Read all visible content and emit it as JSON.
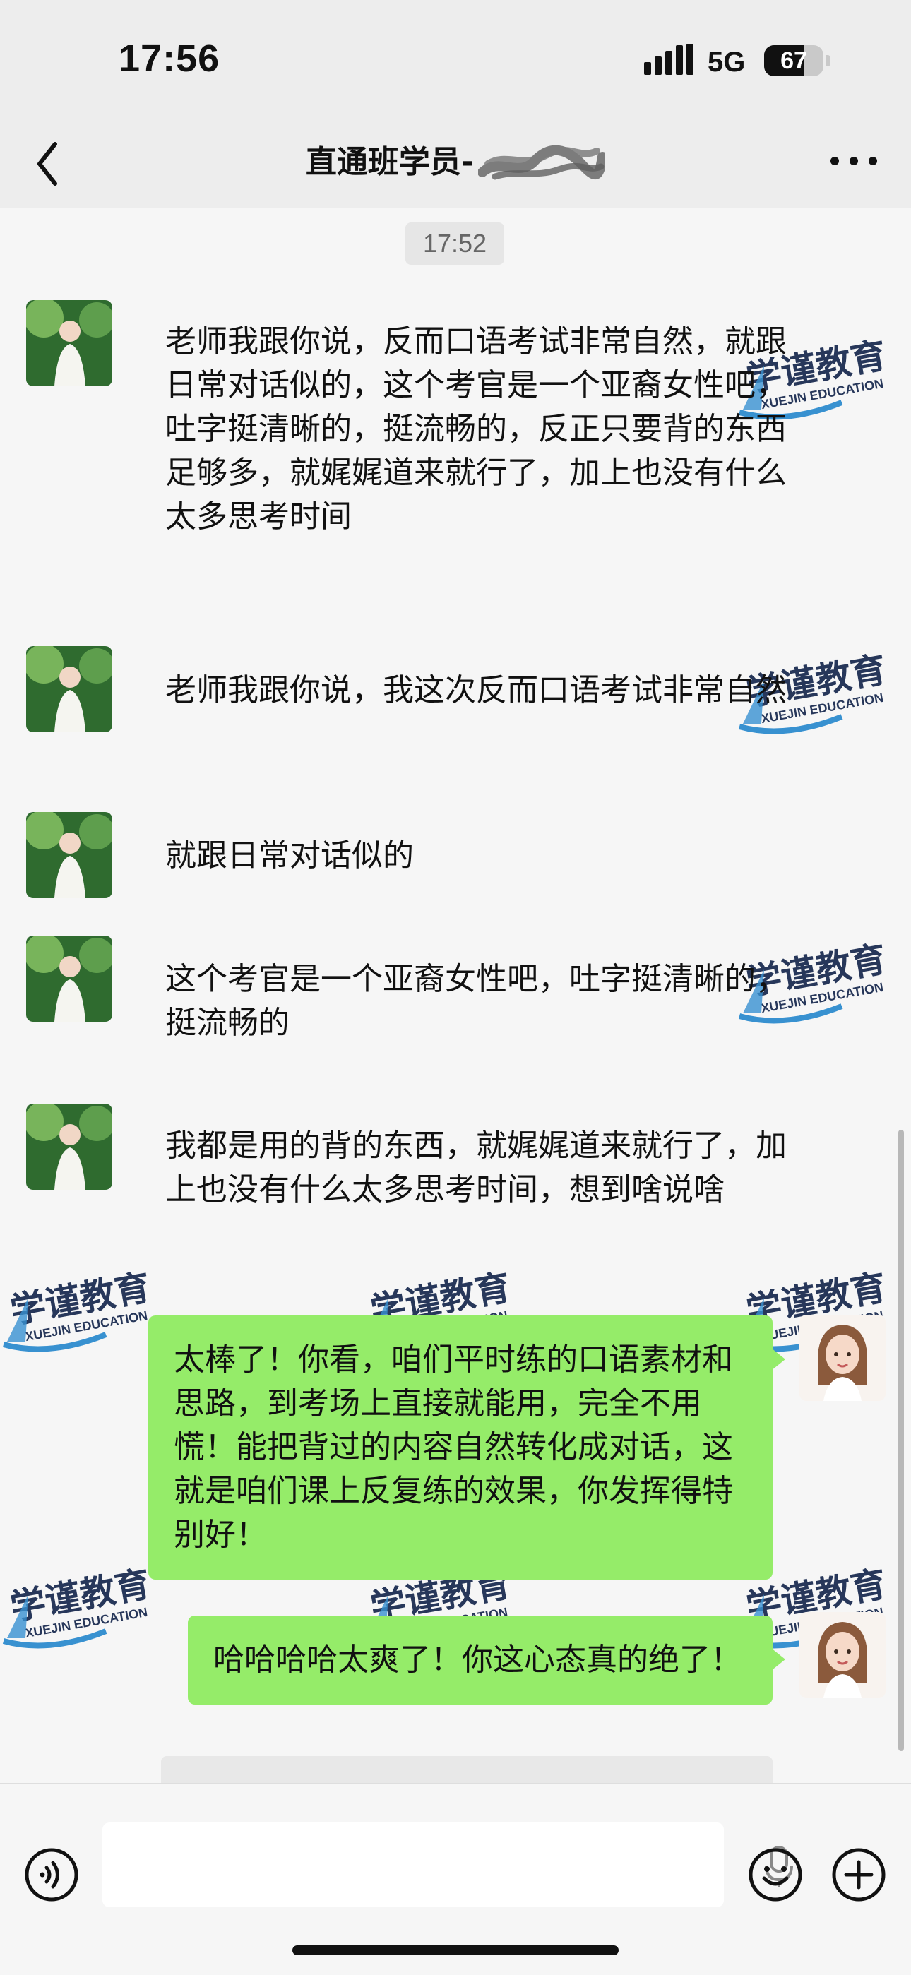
{
  "status_bar": {
    "time": "17:56",
    "network": "5G",
    "battery": "67",
    "battery_level": 0.67
  },
  "nav": {
    "title": "直通班学员-"
  },
  "chat": {
    "timestamp": "17:52",
    "watermark": {
      "name": "学谨教育",
      "subtitle": "XUEJIN EDUCATION"
    },
    "messages": [
      {
        "text": "老师我跟你说，反而口语考试非常自然，就跟日常对话似的，这个考官是一个亚裔女性吧，吐字挺清晰的，挺流畅的，反正只要背的东西足够多，就娓娓道来就行了，加上也没有什么太多思考时间"
      },
      {
        "text": "老师我跟你说，我这次反而口语考试非常自然"
      },
      {
        "text": "就跟日常对话似的"
      },
      {
        "text": "这个考官是一个亚裔女性吧，吐字挺清晰的，挺流畅的"
      },
      {
        "text": "我都是用的背的东西，就娓娓道来就行了，加上也没有什么太多思考时间，想到啥说啥"
      },
      {
        "text": "太棒了！你看，咱们平时练的口语素材和思路，到考场上直接就能用，完全不用慌！能把背过的内容自然转化成对话，这就是咱们课上反复练的效果，你发挥得特别好！"
      },
      {
        "text": "哈哈哈哈太爽了！你这心态真的绝了！"
      }
    ]
  },
  "colors": {
    "outgoing_bubble": "#95ec69",
    "chat_background": "#f6f6f6",
    "header_background": "#ededed",
    "watermark_text": "#1c2d52",
    "watermark_accent": "#2e8ccf"
  },
  "icons": {
    "back": "chevron-left-icon",
    "more": "more-horizontal-icon",
    "voice": "voice-icon",
    "mic": "mic-icon",
    "emoji": "smile-icon",
    "plus": "plus-icon"
  }
}
